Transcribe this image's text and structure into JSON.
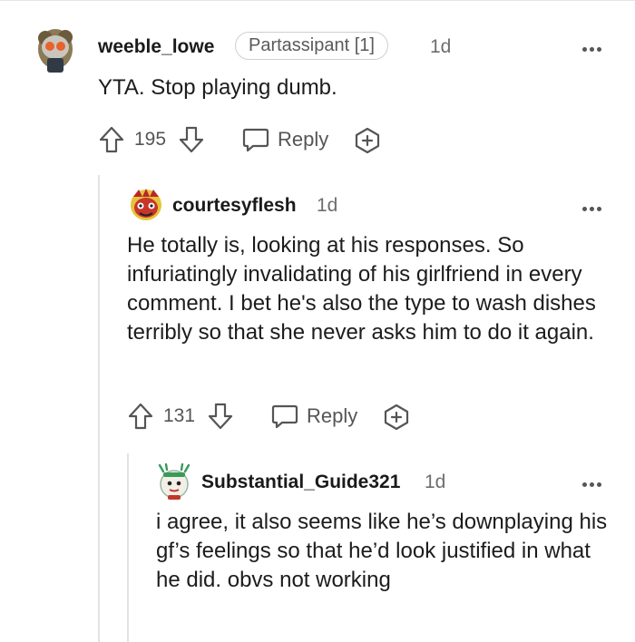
{
  "comments": [
    {
      "author": "weeble_lowe",
      "flair": "Partassipant [1]",
      "time": "1d",
      "text": "YTA. Stop playing dumb.",
      "score": "195",
      "reply_label": "Reply"
    },
    {
      "author": "courtesyflesh",
      "time": "1d",
      "text": "He totally is, looking at his responses. So infuriatingly invalidating of his girlfriend in every comment. I bet he's also the type to wash dishes terribly so that she never asks him to do it again.",
      "score": "131",
      "reply_label": "Reply"
    },
    {
      "author": "Substantial_Guide321",
      "time": "1d",
      "text": "i agree, it also seems like he’s downplaying his gf’s feelings so that he’d look justified in what he did. obvs not working"
    }
  ]
}
